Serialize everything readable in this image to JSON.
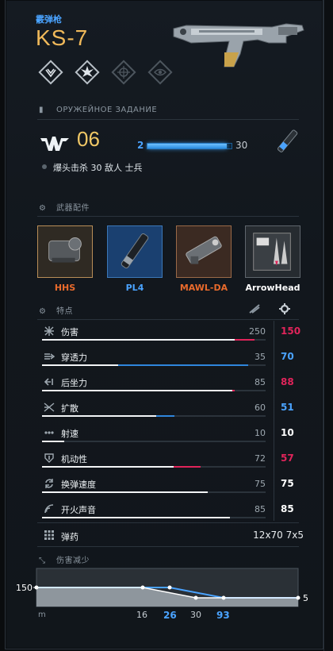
{
  "header": {
    "weapon_class": "霰弹枪",
    "weapon_name": "KS-7"
  },
  "badges": [
    "shield-emblem-icon",
    "burst-emblem-icon",
    "crosshair-emblem-icon",
    "eye-emblem-icon"
  ],
  "assignment": {
    "section_title": "ОРУЖЕЙНОЕ ЗАДАНИЕ",
    "level": "06",
    "progress_min": "2",
    "progress_max": "30",
    "progress_fraction": 0.94,
    "task_text": "爆头击杀 30 敌人 士兵"
  },
  "attachments": {
    "section_title": "武器配件",
    "items": [
      {
        "label": "HHS",
        "color": "#e86a2c",
        "bg": "#2f2a23",
        "border": "#b88d57",
        "icon": "holo-sight-icon"
      },
      {
        "label": "PL4",
        "color": "#4aa3ff",
        "bg": "#1a4070",
        "border": "#3c78b8",
        "icon": "suppressor-icon"
      },
      {
        "label": "MAWL-DA",
        "color": "#e86a2c",
        "bg": "#3b2a22",
        "border": "#9a6a48",
        "icon": "laser-module-icon"
      },
      {
        "label": "ArrowHead",
        "color": "#ffffff",
        "bg": "#262b30",
        "border": "#5f666d",
        "icon": "arrowhead-ammo-icon"
      }
    ]
  },
  "features": {
    "section_title": "特点",
    "stats": [
      {
        "icon": "damage-icon",
        "name": "伤害",
        "value": "250",
        "mod": "150",
        "mod_color": "#e0245a",
        "base": 0.86,
        "delta": 0.09,
        "delta_color": "#e0245a"
      },
      {
        "icon": "penetration-icon",
        "name": "穿透力",
        "value": "35",
        "mod": "70",
        "mod_color": "#4aa3ff",
        "base": 0.34,
        "delta": 0.58,
        "delta_color": "#2f86dc"
      },
      {
        "icon": "recoil-icon",
        "name": "后坐力",
        "value": "85",
        "mod": "88",
        "mod_color": "#e0245a",
        "base": 0.85,
        "delta": 0.01,
        "delta_color": "#e0245a"
      },
      {
        "icon": "spread-icon",
        "name": "扩散",
        "value": "60",
        "mod": "51",
        "mod_color": "#4aa3ff",
        "base": 0.51,
        "delta": 0.08,
        "delta_color": "#2f86dc"
      },
      {
        "icon": "rate-of-fire-icon",
        "name": "射速",
        "value": "10",
        "mod": "10",
        "mod_color": "#ffffff",
        "base": 0.1,
        "delta": 0,
        "delta_color": "#ffffff"
      },
      {
        "icon": "mobility-icon",
        "name": "机动性",
        "value": "72",
        "mod": "57",
        "mod_color": "#e0245a",
        "base": 0.59,
        "delta": 0.12,
        "delta_color": "#e0245a"
      },
      {
        "icon": "reload-icon",
        "name": "换弹速度",
        "value": "75",
        "mod": "75",
        "mod_color": "#ffffff",
        "base": 0.74,
        "delta": 0,
        "delta_color": "#ffffff"
      },
      {
        "icon": "sound-icon",
        "name": "开火声音",
        "value": "85",
        "mod": "85",
        "mod_color": "#ffffff",
        "base": 0.84,
        "delta": 0,
        "delta_color": "#ffffff"
      }
    ]
  },
  "ammo": {
    "name": "弹药",
    "value": "12x70 7x5"
  },
  "falloff": {
    "section_title": "伤害减少",
    "max_damage": "150",
    "min_damage": "5",
    "unit": "m",
    "ticks": [
      {
        "label": "16",
        "color": "#c5ccd2"
      },
      {
        "label": "26",
        "color": "#4aa3ff"
      },
      {
        "label": "30",
        "color": "#c5ccd2"
      },
      {
        "label": "93",
        "color": "#4aa3ff"
      }
    ]
  }
}
